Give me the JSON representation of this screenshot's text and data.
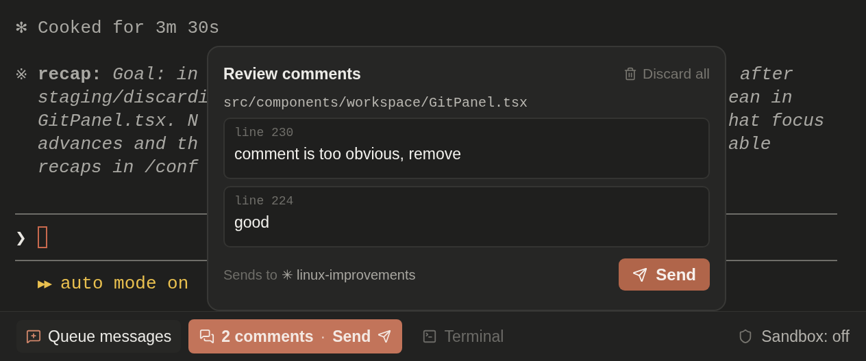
{
  "terminal": {
    "status": {
      "icon": "✻",
      "text": "Cooked for 3m 30s"
    },
    "recap": {
      "icon": "※",
      "label": "recap:",
      "lines": [
        {
          "left": "Goal: in",
          "right": "after"
        },
        {
          "left": "staging/discardi",
          "right": "ean in"
        },
        {
          "left": "GitPanel.tsx. N",
          "right": "hat focus"
        },
        {
          "left": "advances and th",
          "right": "able"
        },
        {
          "left": "recaps in /conf"
        }
      ]
    },
    "prompt": {
      "symbol": "❯"
    },
    "mode": {
      "icon": "▶▶",
      "text": "auto mode on"
    }
  },
  "review_popover": {
    "title": "Review comments",
    "discard_label": "Discard all",
    "file_path": "src/components/workspace/GitPanel.tsx",
    "comments": [
      {
        "line": "line 230",
        "text": "comment is too obvious, remove"
      },
      {
        "line": "line 224",
        "text": "good"
      }
    ],
    "sends_to": {
      "prefix": "Sends to",
      "icon": "✳",
      "target": "linux-improvements"
    },
    "send_button": "Send"
  },
  "bottom_bar": {
    "queue_button": "Queue messages",
    "comments_button": {
      "count": "2 comments",
      "separator": "·",
      "action": "Send"
    },
    "terminal_button": {
      "label": "Terminal",
      "disabled": true
    },
    "sandbox": "Sandbox: off"
  }
}
